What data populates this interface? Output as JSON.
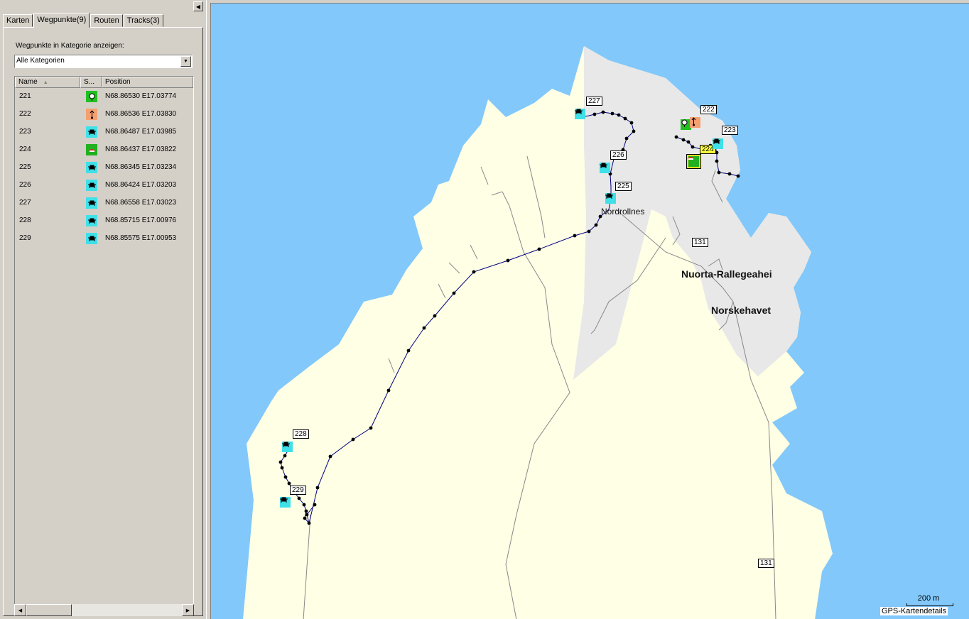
{
  "tabs": [
    {
      "label": "Karten",
      "active": false
    },
    {
      "label": "Wegpunkte(9)",
      "active": true
    },
    {
      "label": "Routen",
      "active": false
    },
    {
      "label": "Tracks(3)",
      "active": false
    }
  ],
  "filter": {
    "label": "Wegpunkte in Kategorie anzeigen:",
    "value": "Alle Kategorien"
  },
  "columns": {
    "name": "Name",
    "symbol": "S...",
    "position": "Position"
  },
  "waypoints": [
    {
      "name": "221",
      "symbol": "scenic-area-icon",
      "position": "N68.86530 E17.03774"
    },
    {
      "name": "222",
      "symbol": "trailhead-icon",
      "position": "N68.86536 E17.03830"
    },
    {
      "name": "223",
      "symbol": "bench-icon",
      "position": "N68.86487 E17.03985"
    },
    {
      "name": "224",
      "symbol": "boat-icon",
      "position": "N68.86437 E17.03822"
    },
    {
      "name": "225",
      "symbol": "bench-icon",
      "position": "N68.86345 E17.03234"
    },
    {
      "name": "226",
      "symbol": "bench-icon",
      "position": "N68.86424 E17.03203"
    },
    {
      "name": "227",
      "symbol": "bench-icon",
      "position": "N68.86558 E17.03023"
    },
    {
      "name": "228",
      "symbol": "bench-icon",
      "position": "N68.85715 E17.00976"
    },
    {
      "name": "229",
      "symbol": "bench-icon",
      "position": "N68.85575 E17.00953"
    }
  ],
  "map": {
    "places": {
      "nordrollnes": "Nordrollnes",
      "nuorta": "Nuorta-Rallegeahei",
      "norskehavet": "Norskehavet"
    },
    "road_numbers": {
      "road1": "131",
      "road2": "131"
    },
    "scale": "200 m",
    "details_label": "GPS-Kartendetails",
    "colors": {
      "water": "#82c8fa",
      "land": "#ffffe6",
      "urban": "#e8e8e8",
      "track": "#00007f"
    }
  }
}
